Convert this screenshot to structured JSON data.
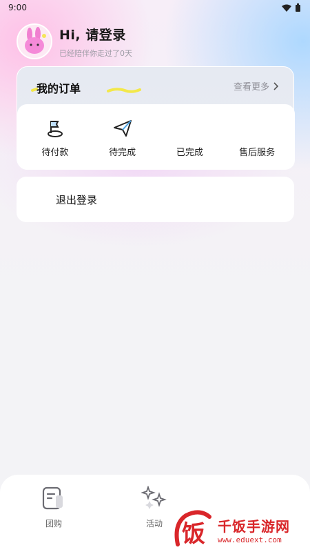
{
  "status_bar": {
    "time": "9:00",
    "wifi_icon": "wifi-icon",
    "battery_icon": "battery-icon"
  },
  "profile": {
    "greeting": "Hi, 请登录",
    "subtitle": "已经陪伴你走过了0天",
    "avatar_icon": "bunny-avatar-icon"
  },
  "orders": {
    "title": "我的订单",
    "more_label": "查看更多",
    "items": [
      {
        "label": "待付款",
        "icon": "flag-icon"
      },
      {
        "label": "待完成",
        "icon": "paper-plane-icon"
      },
      {
        "label": "已完成",
        "icon": ""
      },
      {
        "label": "售后服务",
        "icon": ""
      }
    ]
  },
  "logout": {
    "label": "退出登录"
  },
  "tabbar": {
    "tabs": [
      {
        "label": "团购",
        "icon": "document-icon"
      },
      {
        "label": "活动",
        "icon": "sparkle-icon"
      }
    ]
  },
  "watermark": {
    "brand": "千饭手游网",
    "url": "www.eduext.com",
    "logo_char": "饭"
  },
  "colors": {
    "accent_yellow": "#f3e84a",
    "watermark_red": "#d9262a",
    "icon_blue": "#4aa3e6"
  }
}
